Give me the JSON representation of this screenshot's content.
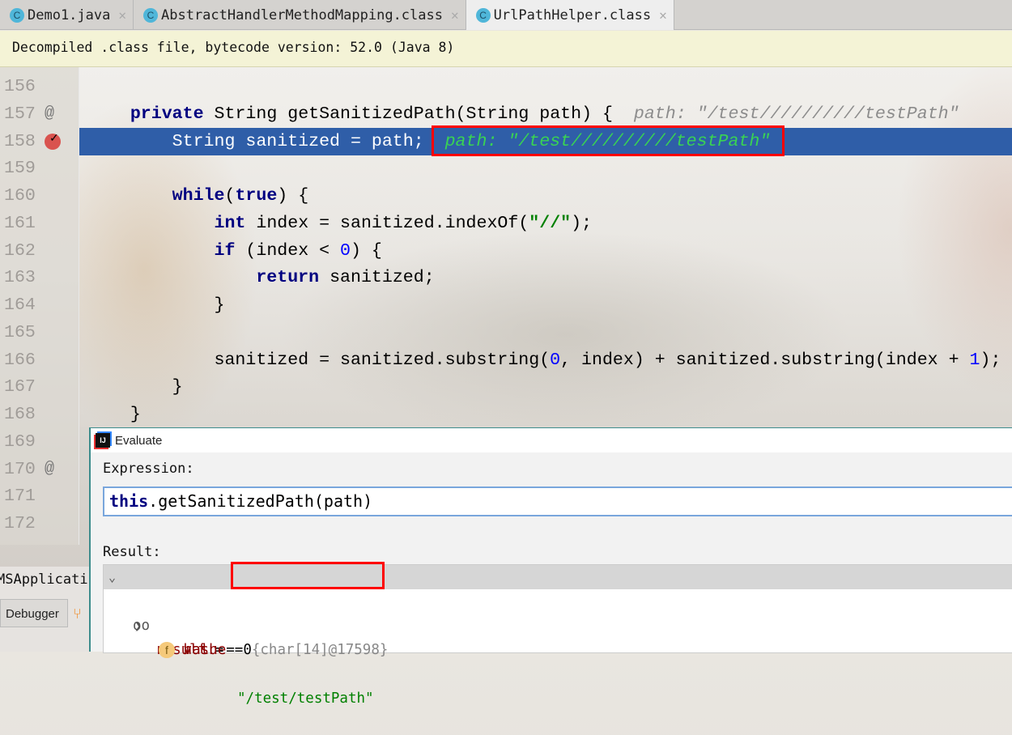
{
  "tabs": [
    {
      "label": "Demo1.java",
      "icon": "class-icon",
      "active": false
    },
    {
      "label": "AbstractHandlerMethodMapping.class",
      "icon": "class-icon",
      "active": false
    },
    {
      "label": "UrlPathHelper.class",
      "icon": "class-icon",
      "active": true
    }
  ],
  "banner": "Decompiled .class file, bytecode version: 52.0 (Java 8)",
  "colors": {
    "highlight": "#2f5ea8",
    "annotation_box": "#ff0000",
    "hint_inline": "#39d353"
  },
  "lines": [
    {
      "n": "156",
      "seg": []
    },
    {
      "n": "157",
      "mark": "@",
      "seg": [
        {
          "k": "plain",
          "t": "    "
        },
        {
          "k": "kw",
          "t": "private"
        },
        {
          "k": "plain",
          "t": " String getSanitizedPath(String path) {  "
        },
        {
          "k": "hint",
          "t": "path: \"/test//////////testPath\""
        }
      ]
    },
    {
      "n": "158",
      "breakpoint": true,
      "seg": [
        {
          "k": "plain",
          "t": "        String sanitized = path;  "
        },
        {
          "k": "hint",
          "t": "path: \"/test//////////testPath\""
        }
      ]
    },
    {
      "n": "159",
      "seg": []
    },
    {
      "n": "160",
      "seg": [
        {
          "k": "plain",
          "t": "        "
        },
        {
          "k": "kw",
          "t": "while"
        },
        {
          "k": "plain",
          "t": "("
        },
        {
          "k": "kw",
          "t": "true"
        },
        {
          "k": "plain",
          "t": ") {"
        }
      ]
    },
    {
      "n": "161",
      "seg": [
        {
          "k": "plain",
          "t": "            "
        },
        {
          "k": "kw",
          "t": "int"
        },
        {
          "k": "plain",
          "t": " index = sanitized.indexOf("
        },
        {
          "k": "str",
          "t": "\"//\""
        },
        {
          "k": "plain",
          "t": ");"
        }
      ]
    },
    {
      "n": "162",
      "seg": [
        {
          "k": "plain",
          "t": "            "
        },
        {
          "k": "kw",
          "t": "if"
        },
        {
          "k": "plain",
          "t": " (index < "
        },
        {
          "k": "num",
          "t": "0"
        },
        {
          "k": "plain",
          "t": ") {"
        }
      ]
    },
    {
      "n": "163",
      "seg": [
        {
          "k": "plain",
          "t": "                "
        },
        {
          "k": "kw",
          "t": "return"
        },
        {
          "k": "plain",
          "t": " sanitized;"
        }
      ]
    },
    {
      "n": "164",
      "seg": [
        {
          "k": "plain",
          "t": "            }"
        }
      ]
    },
    {
      "n": "165",
      "seg": []
    },
    {
      "n": "166",
      "seg": [
        {
          "k": "plain",
          "t": "            sanitized = sanitized.substring("
        },
        {
          "k": "num",
          "t": "0"
        },
        {
          "k": "plain",
          "t": ", index) + sanitized.substring(index + "
        },
        {
          "k": "num",
          "t": "1"
        },
        {
          "k": "plain",
          "t": ");"
        }
      ]
    },
    {
      "n": "167",
      "seg": [
        {
          "k": "plain",
          "t": "        }"
        }
      ]
    },
    {
      "n": "168",
      "seg": [
        {
          "k": "plain",
          "t": "    }"
        }
      ]
    },
    {
      "n": "169",
      "seg": []
    },
    {
      "n": "170",
      "mark": "@",
      "seg": []
    },
    {
      "n": "171",
      "seg": []
    },
    {
      "n": "172",
      "seg": []
    }
  ],
  "bottom": {
    "app_name": "MSApplicati",
    "debugger_tab": "Debugger"
  },
  "evaluate": {
    "title": "Evaluate",
    "expression_label": "Expression:",
    "expression_keyword": "this",
    "expression_rest": ".getSanitizedPath(path)",
    "result_label": "Result:",
    "result": {
      "name": "result",
      "eq": " = ",
      "value": "\"/test/testPath\""
    },
    "children": [
      {
        "name": "value",
        "eq": " = ",
        "value": "{char[14]@17598}",
        "expandable": true
      },
      {
        "name": "hash",
        "eq": " = ",
        "value": "0",
        "expandable": false
      }
    ]
  }
}
